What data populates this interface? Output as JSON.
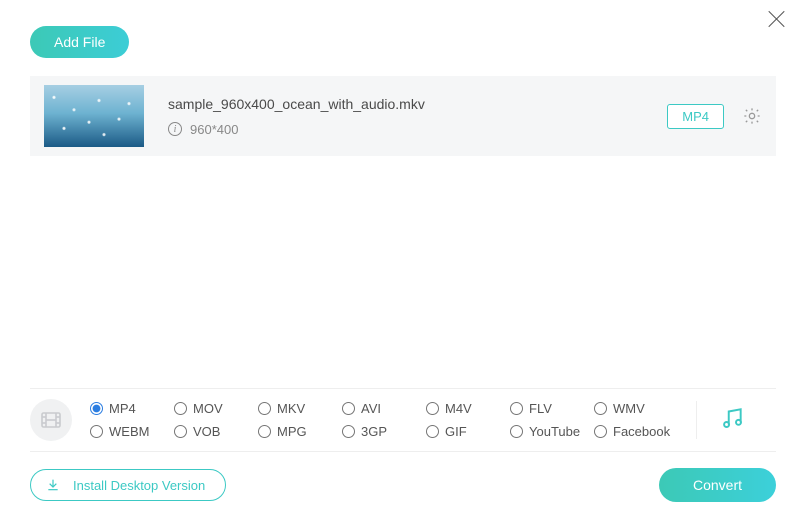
{
  "header": {
    "add_file_label": "Add File"
  },
  "file": {
    "name": "sample_960x400_ocean_with_audio.mkv",
    "resolution": "960*400",
    "output_format": "MP4"
  },
  "formats": {
    "selected": "MP4",
    "options": [
      "MP4",
      "MOV",
      "MKV",
      "AVI",
      "M4V",
      "FLV",
      "WMV",
      "WEBM",
      "VOB",
      "MPG",
      "3GP",
      "GIF",
      "YouTube",
      "Facebook"
    ]
  },
  "footer": {
    "install_label": "Install Desktop Version",
    "convert_label": "Convert"
  }
}
